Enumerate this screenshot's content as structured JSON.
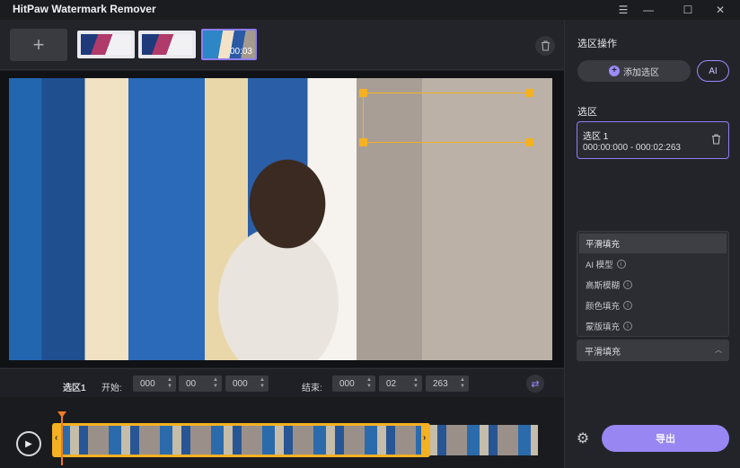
{
  "window": {
    "title": "HitPaw Watermark Remover",
    "controls": {
      "menu": "☰",
      "minimize": "—",
      "maximize": "☐",
      "close": "✕"
    }
  },
  "thumbstrip": {
    "add_label": "+",
    "thumbs": [
      {
        "time": ""
      },
      {
        "time": ""
      },
      {
        "time": "00:03"
      }
    ],
    "active_index": 2
  },
  "colors": {
    "accent": "#9886f2",
    "selection": "#f4b122",
    "playhead": "#f07a24"
  },
  "controls": {
    "selection_label": "选区1",
    "start_label": "开始:",
    "start": {
      "h": "000",
      "m": "00",
      "ms": "000"
    },
    "end_label": "结束:",
    "end": {
      "h": "000",
      "m": "02",
      "ms": "263"
    }
  },
  "panel": {
    "ops_title": "选区操作",
    "add_selection": "添加选区",
    "ai_label": "AI",
    "selection_title": "选区",
    "selection_card": {
      "name": "选区 1",
      "time": "000:00:000 - 000:02:263"
    },
    "fill_options": [
      {
        "label": "平滑填充",
        "info": false
      },
      {
        "label": "AI 模型",
        "info": true
      },
      {
        "label": "高斯模糊",
        "info": true
      },
      {
        "label": "颜色填充",
        "info": true
      },
      {
        "label": "蒙版填充",
        "info": true
      }
    ],
    "selected_fill": "平滑填充",
    "export_label": "导出"
  }
}
